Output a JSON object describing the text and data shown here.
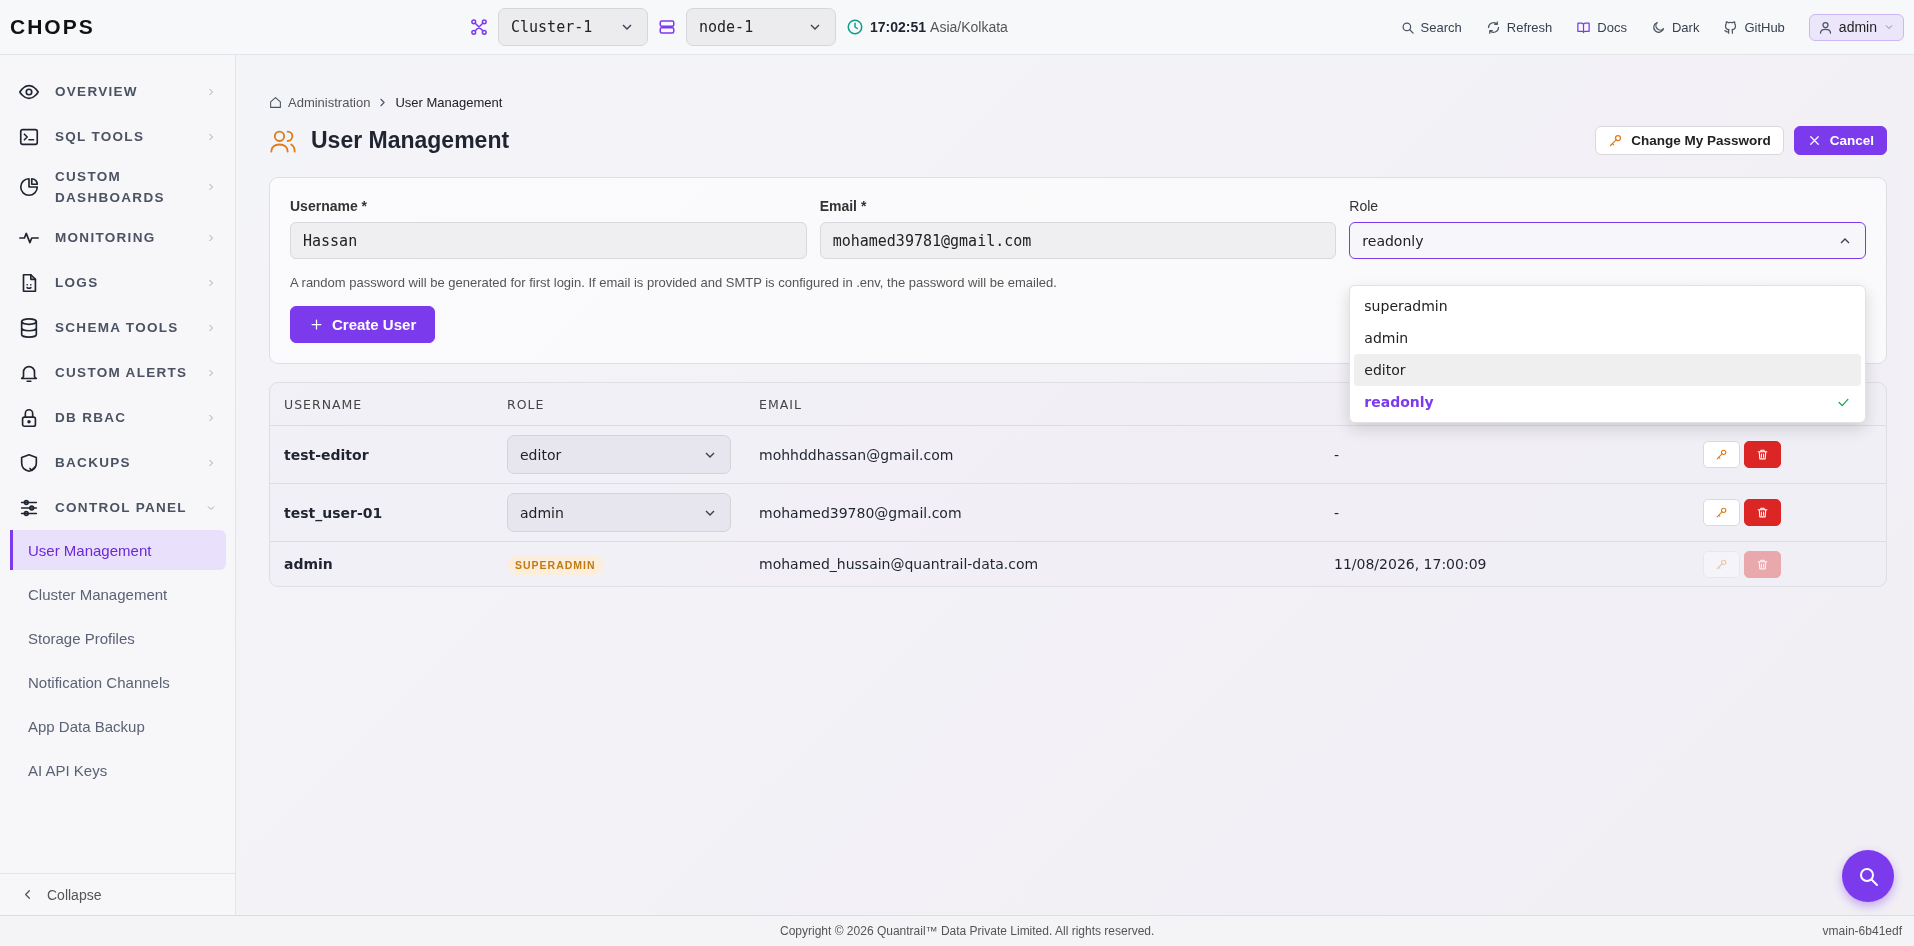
{
  "header": {
    "logo": "CHOPS",
    "cluster": "Cluster-1",
    "node": "node-1",
    "time": "17:02:51",
    "timezone": "Asia/Kolkata",
    "actions": [
      "Search",
      "Refresh",
      "Docs",
      "Dark",
      "GitHub"
    ],
    "user": "admin"
  },
  "sidebar": {
    "items": [
      {
        "label": "OVERVIEW",
        "expanded": false
      },
      {
        "label": "SQL TOOLS",
        "expanded": false
      },
      {
        "label": "CUSTOM DASHBOARDS",
        "expanded": false
      },
      {
        "label": "MONITORING",
        "expanded": false
      },
      {
        "label": "LOGS",
        "expanded": false
      },
      {
        "label": "SCHEMA TOOLS",
        "expanded": false
      },
      {
        "label": "CUSTOM ALERTS",
        "expanded": false
      },
      {
        "label": "DB RBAC",
        "expanded": false
      },
      {
        "label": "BACKUPS",
        "expanded": false
      },
      {
        "label": "CONTROL PANEL",
        "expanded": true,
        "children": [
          {
            "label": "User Management",
            "selected": true
          },
          {
            "label": "Cluster Management",
            "selected": false
          },
          {
            "label": "Storage Profiles",
            "selected": false
          },
          {
            "label": "Notification Channels",
            "selected": false
          },
          {
            "label": "App Data Backup",
            "selected": false
          },
          {
            "label": "AI API Keys",
            "selected": false
          }
        ]
      }
    ],
    "collapse": "Collapse"
  },
  "breadcrumb": [
    "Administration",
    "User Management"
  ],
  "page_title": "User Management",
  "buttons": {
    "change_password": "Change My Password",
    "cancel": "Cancel"
  },
  "form": {
    "username": {
      "label": "Username *",
      "value": "Hassan"
    },
    "email": {
      "label": "Email *",
      "value": "mohamed39781@gmail.com"
    },
    "role": {
      "label": "Role",
      "value": "readonly",
      "expanded": true,
      "options": [
        {
          "label": "superadmin",
          "selected": false,
          "hovered": false
        },
        {
          "label": "admin",
          "selected": false,
          "hovered": false
        },
        {
          "label": "editor",
          "selected": false,
          "hovered": true
        },
        {
          "label": "readonly",
          "selected": true,
          "hovered": false
        }
      ]
    },
    "hint": "A random password will be generated for first login. If email is provided and SMTP is configured in .env, the password will be emailed.",
    "submit": "Create User"
  },
  "table": {
    "columns": [
      "USERNAME",
      "ROLE",
      "EMAIL"
    ],
    "rows": [
      {
        "username": "test-editor",
        "role": "editor",
        "kind": "select",
        "email": "mohhddhassan@gmail.com",
        "last_login": "-",
        "disabled": false
      },
      {
        "username": "test_user-01",
        "role": "admin",
        "kind": "select",
        "email": "mohamed39780@gmail.com",
        "last_login": "-",
        "disabled": false
      },
      {
        "username": "admin",
        "role": "SUPERADMIN",
        "kind": "badge",
        "email": "mohamed_hussain@quantrail-data.com",
        "last_login": "11/08/2026, 17:00:09",
        "disabled": true
      }
    ]
  },
  "footer": {
    "copyright": "Copyright © 2026 Quantrail™ Data Private Limited. All rights reserved.",
    "version": "vmain-6b41edf"
  }
}
